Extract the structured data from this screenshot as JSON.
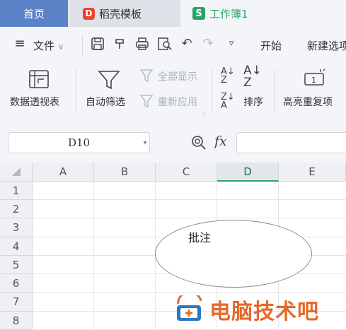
{
  "tabs": [
    {
      "label": "首页"
    },
    {
      "label": "稻壳模板"
    },
    {
      "label": "工作簿1"
    }
  ],
  "menu": {
    "file_label": "文件",
    "start_label": "开始",
    "new_select_label": "新建选项"
  },
  "ribbon": {
    "pivot_label": "数据透视表",
    "autofilter_label": "自动筛选",
    "show_all_label": "全部显示",
    "reapply_label": "重新应用",
    "sort_label": "排序",
    "highlight_dup_label": "高亮重复项"
  },
  "formula_bar": {
    "name_box_value": "D10",
    "fx_label": "fx",
    "formula_value": ""
  },
  "sheet": {
    "columns": [
      "A",
      "B",
      "C",
      "D",
      "E"
    ],
    "rows": [
      "1",
      "2",
      "3",
      "4",
      "5",
      "6",
      "7",
      "8"
    ],
    "selected_column": "D",
    "comment_text": "批注"
  },
  "watermark": {
    "text": "电脑技术吧"
  },
  "colors": {
    "home_tab": "#5b82c6",
    "workbook_green": "#27a567",
    "watermark_orange": "#e46a2a"
  }
}
